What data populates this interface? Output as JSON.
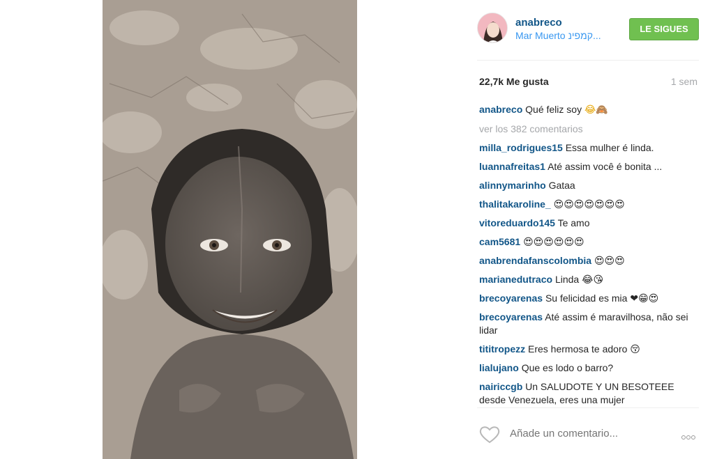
{
  "post": {
    "username": "anabreco",
    "location": "Mar Muerto קמפינ...",
    "follow_label": "LE SIGUES",
    "likes": "22,7k Me gusta",
    "time": "1 sem",
    "caption": {
      "user": "anabreco",
      "text": "Qué feliz soy ",
      "emoji": "😂🙈"
    },
    "view_all": "ver los 382 comentarios",
    "comments": [
      {
        "user": "milla_rodrigues15",
        "text": "Essa mulher é linda."
      },
      {
        "user": "luannafreitas1",
        "text": "Até assim você é bonita ..."
      },
      {
        "user": "alinnymarinho",
        "text": "Gataa"
      },
      {
        "user": "thalitakaroline_",
        "text": "😍😍😍😍😍😍😍"
      },
      {
        "user": "vitoreduardo145",
        "text": "Te amo"
      },
      {
        "user": "cam5681",
        "text": "😍😍😍😍😍😍"
      },
      {
        "user": "anabrendafanscolombia",
        "text": "😍😍😍"
      },
      {
        "user": "marianedutraco",
        "text": "Linda 😂😘"
      },
      {
        "user": "brecoyarenas",
        "text": "Su felicidad es mia ❤😁😍"
      },
      {
        "user": "brecoyarenas",
        "text": "Até assim é maravilhosa, não sei lidar"
      },
      {
        "user": "tititropezz",
        "text": "Eres hermosa te adoro 😚"
      },
      {
        "user": "lialujano",
        "text": "Que es lodo o barro?"
      },
      {
        "user": "nairiccgb",
        "text": "Un SALUDOTE Y UN BESOTEEE desde Venezuela, eres una mujer"
      }
    ],
    "add_comment_placeholder": "Añade un comentario..."
  },
  "icons": {
    "heart": "heart-outline-icon",
    "more": "more-options-icon"
  },
  "colors": {
    "username": "#125688",
    "location": "#3897f0",
    "follow_button": "#70c050",
    "muted": "#a5a7aa"
  }
}
